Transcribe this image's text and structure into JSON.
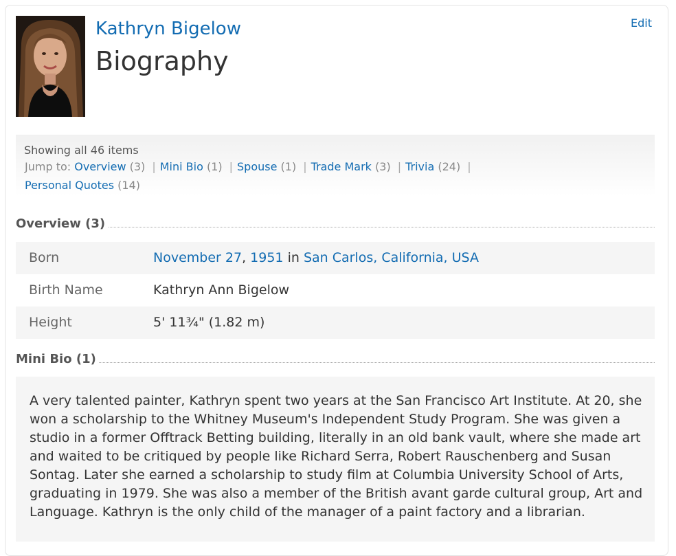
{
  "person": {
    "name": "Kathryn Bigelow",
    "page_title": "Biography",
    "edit_label": "Edit"
  },
  "jump": {
    "showing": "Showing all 46 items",
    "label": "Jump to:",
    "items": [
      {
        "label": "Overview",
        "count": "(3)"
      },
      {
        "label": "Mini Bio",
        "count": "(1)"
      },
      {
        "label": "Spouse",
        "count": "(1)"
      },
      {
        "label": "Trade Mark",
        "count": "(3)"
      },
      {
        "label": "Trivia",
        "count": "(24)"
      },
      {
        "label": "Personal Quotes",
        "count": "(14)"
      }
    ],
    "separator": "|"
  },
  "overview": {
    "heading": "Overview (3)",
    "born_label": "Born",
    "born_date": "November 27",
    "born_comma": ",",
    "born_year": "1951",
    "born_in": "in",
    "born_place": "San Carlos, California, USA",
    "birth_name_label": "Birth Name",
    "birth_name": "Kathryn Ann Bigelow",
    "height_label": "Height",
    "height": "5' 11¾\" (1.82 m)"
  },
  "mini_bio": {
    "heading": "Mini Bio (1)",
    "text": "A very talented painter, Kathryn spent two years at the San Francisco Art Institute. At 20, she won a scholarship to the Whitney Museum's Independent Study Program. She was given a studio in a former Offtrack Betting building, literally in an old bank vault, where she made art and waited to be critiqued by people like Richard Serra, Robert Rauschenberg and Susan Sontag. Later she earned a scholarship to study film at Columbia University School of Arts, graduating in 1979. She was also a member of the British avant garde cultural group, Art and Language. Kathryn is the only child of the manager of a paint factory and a librarian."
  },
  "colors": {
    "link": "#136cb2",
    "text": "#333333",
    "row_shade": "#f5f5f5"
  }
}
